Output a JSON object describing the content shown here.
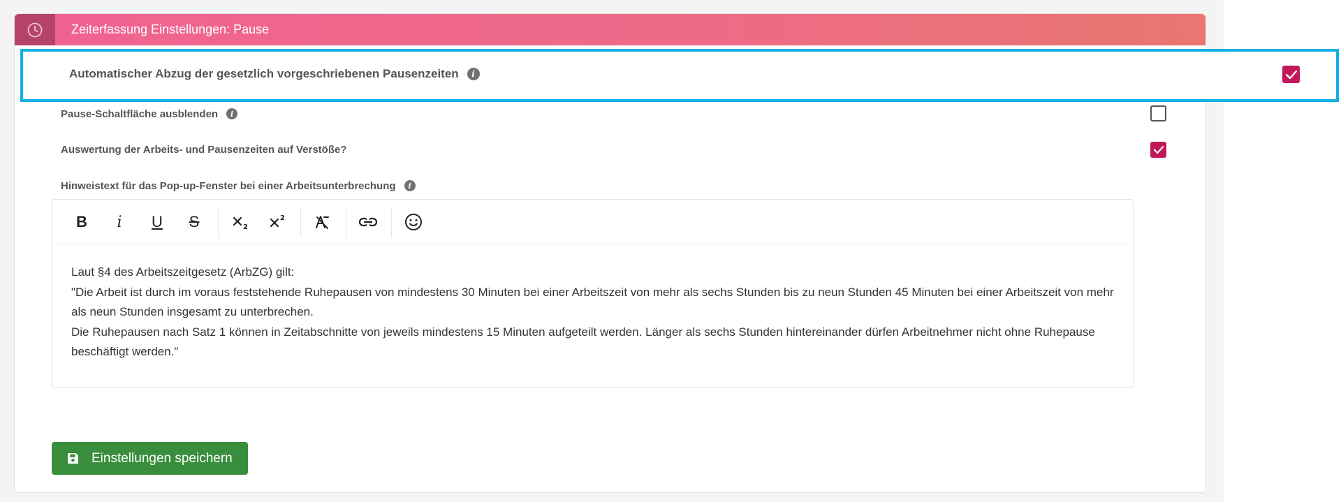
{
  "panel": {
    "title": "Zeiterfassung Einstellungen: Pause",
    "header_icon": "clock-icon"
  },
  "colors": {
    "accent": "#c2185b",
    "header_gradient_start": "#f06292",
    "header_gradient_end": "#e9766f",
    "highlight_border": "#13b0e3",
    "save_button": "#388e3c"
  },
  "settings": [
    {
      "label": "Automatischer Abzug der gesetzlich vorgeschriebenen Pausenzeiten",
      "checked": true,
      "has_info": true,
      "highlighted": true
    },
    {
      "label": "Pause-Schaltfläche ausblenden",
      "checked": false,
      "has_info": true
    },
    {
      "label": "Auswertung der Arbeits- und Pausenzeiten auf Verstöße?",
      "checked": true,
      "has_info": false
    }
  ],
  "editor": {
    "label": "Hinweistext für das Pop-up-Fenster bei einer Arbeitsunterbrechung",
    "toolbar": {
      "bold": "B",
      "italic": "i",
      "underline": "U",
      "strike": "S"
    },
    "content": [
      "Laut §4 des Arbeitszeitgesetz (ArbZG) gilt:",
      "\"Die Arbeit ist durch im voraus feststehende Ruhepausen von mindestens 30 Minuten bei einer Arbeitszeit von mehr als sechs Stunden bis zu neun Stunden 45 Minuten bei einer Arbeitszeit von mehr als neun Stunden insgesamt zu unterbrechen.",
      "Die Ruhepausen nach Satz 1 können in Zeitabschnitte von jeweils mindestens 15 Minuten aufgeteilt werden. Länger als sechs Stunden hintereinander dürfen Arbeitnehmer nicht ohne Ruhepause beschäftigt werden.\""
    ]
  },
  "save_button": {
    "label": "Einstellungen speichern",
    "icon": "floppy-disk-icon"
  }
}
